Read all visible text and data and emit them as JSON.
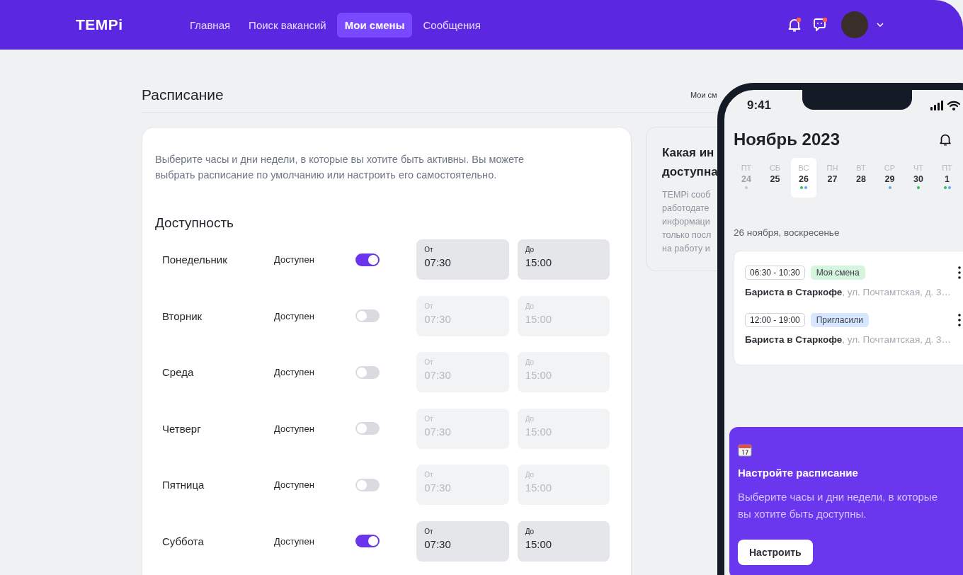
{
  "header": {
    "brand": "TEMPi",
    "nav": [
      {
        "label": "Главная",
        "selected": false
      },
      {
        "label": "Поиск вакансий",
        "selected": false
      },
      {
        "label": "Мои смены",
        "selected": true
      },
      {
        "label": "Сообщения",
        "selected": false
      }
    ],
    "bell_unread": true,
    "chat_unread": true
  },
  "schedule": {
    "title": "Расписание",
    "tab_hint": "Мои см",
    "description": "Выберите часы и дни недели, в которые вы хотите быть активны. Вы можете выбрать расписание по умолчанию или настроить его самостоятельно.",
    "availability_title": "Доступность",
    "days": [
      {
        "name": "Понедельник",
        "status": "Доступен",
        "on": true,
        "from_label": "От",
        "from": "07:30",
        "to_label": "До",
        "to": "15:00"
      },
      {
        "name": "Вторник",
        "status": "Доступен",
        "on": false,
        "from_label": "От",
        "from": "07:30",
        "to_label": "До",
        "to": "15:00"
      },
      {
        "name": "Среда",
        "status": "Доступен",
        "on": false,
        "from_label": "От",
        "from": "07:30",
        "to_label": "До",
        "to": "15:00"
      },
      {
        "name": "Четверг",
        "status": "Доступен",
        "on": false,
        "from_label": "От",
        "from": "07:30",
        "to_label": "До",
        "to": "15:00"
      },
      {
        "name": "Пятница",
        "status": "Доступен",
        "on": false,
        "from_label": "От",
        "from": "07:30",
        "to_label": "До",
        "to": "15:00"
      },
      {
        "name": "Суббота",
        "status": "Доступен",
        "on": true,
        "from_label": "От",
        "from": "07:30",
        "to_label": "До",
        "to": "15:00"
      }
    ]
  },
  "info_card": {
    "title_lines": [
      "Какая ин",
      "доступна"
    ],
    "body_lines": [
      "TEMPi сооб",
      "работодате",
      "информаци",
      "только посл",
      "на работу и"
    ]
  },
  "phone": {
    "time": "9:41",
    "month": "Ноябрь 2023",
    "days": [
      {
        "weekday": "ПТ",
        "date": "24",
        "selected": false,
        "past": true,
        "dots": [
          {
            "color": "#c4c7cc"
          }
        ]
      },
      {
        "weekday": "СБ",
        "date": "25",
        "selected": false,
        "past": false
      },
      {
        "weekday": "ВС",
        "date": "26",
        "selected": true,
        "past": false,
        "dots": [
          {
            "color": "#22c55e"
          },
          {
            "color": "#60a5fa"
          }
        ]
      },
      {
        "weekday": "ПН",
        "date": "27",
        "selected": false,
        "past": false
      },
      {
        "weekday": "ВТ",
        "date": "28",
        "selected": false,
        "past": false
      },
      {
        "weekday": "СР",
        "date": "29",
        "selected": false,
        "past": false,
        "dots": [
          {
            "color": "#60a5fa"
          }
        ]
      },
      {
        "weekday": "ЧТ",
        "date": "30",
        "selected": false,
        "past": false,
        "dots": [
          {
            "color": "#22c55e"
          }
        ]
      },
      {
        "weekday": "ПТ",
        "date": "1",
        "selected": false,
        "past": false,
        "dots": [
          {
            "color": "#22c55e"
          },
          {
            "color": "#60a5fa"
          }
        ]
      }
    ],
    "date_heading": "26 ноября, воскресенье",
    "shifts": [
      {
        "time": "06:30 - 10:30",
        "tag": "Моя смена",
        "color": "#d5f5de",
        "title": "Бариста в Старкофе",
        "address": ", ул. Почтамтская, д. 3…"
      },
      {
        "time": "12:00 - 19:00",
        "tag": "Пригласили",
        "color": "#d6e7ff",
        "title": "Бариста в Старкофе",
        "address": ", ул. Почтамтская, д. 3…"
      }
    ],
    "promo": {
      "title": "Настройте расписание",
      "text": "Выберите часы и дни недели, в которые вы хотите быть доступны.",
      "button": "Настроить"
    }
  }
}
